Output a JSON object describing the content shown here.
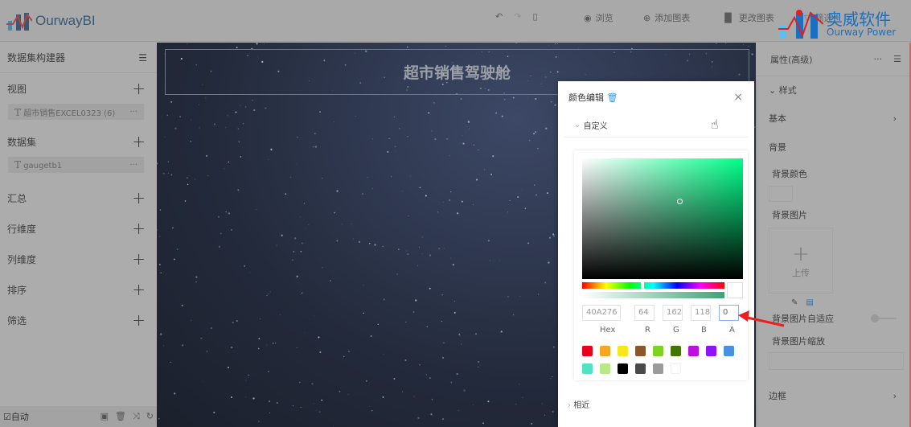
{
  "app": {
    "name": "OurwayBI"
  },
  "toolbar": {
    "preview": "浏览",
    "add_chart": "添加图表",
    "change_chart": "更改图表",
    "filter": "筛选"
  },
  "watermark": {
    "cn": "奥威软件",
    "en": "Ourway Power"
  },
  "left": {
    "title": "数据集构建器",
    "sections": [
      {
        "label": "视图",
        "item": "超市销售EXCEL0323 (6)"
      },
      {
        "label": "数据集",
        "item": "gaugetb1"
      },
      {
        "label": "汇总"
      },
      {
        "label": "行维度"
      },
      {
        "label": "列维度"
      },
      {
        "label": "排序"
      },
      {
        "label": "筛选"
      }
    ],
    "footer": {
      "auto": "自动"
    }
  },
  "canvas": {
    "title": "超市销售驾驶舱"
  },
  "right": {
    "title": "属性(高级)",
    "style": "样式",
    "basic": "基本",
    "background": "背景",
    "bg_color": "背景颜色",
    "bg_image": "背景图片",
    "upload": "上传",
    "bg_fit": "背景图片自适应",
    "bg_scale": "背景图片缩放",
    "border": "边框"
  },
  "dialog": {
    "title": "颜色编辑",
    "custom": "自定义",
    "similar": "相近",
    "hex": "40A276",
    "r": "64",
    "g": "162",
    "b": "118",
    "a": "0",
    "labels": {
      "hex": "Hex",
      "r": "R",
      "g": "G",
      "b": "B",
      "a": "A"
    },
    "swatches": [
      "#e8001c",
      "#f5a623",
      "#f8e71c",
      "#8b572a",
      "#7ed321",
      "#417505",
      "#bd10e0",
      "#9013fe",
      "#4a90e2",
      "#50e3c2",
      "#b8e986",
      "#000000",
      "#4a4a4a",
      "#9b9b9b",
      "#ffffff"
    ]
  }
}
